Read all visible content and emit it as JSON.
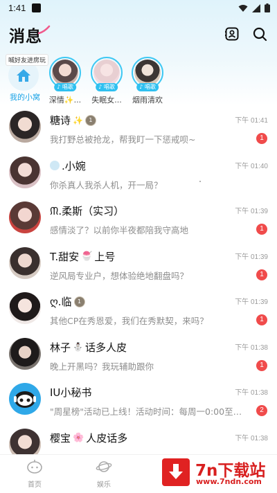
{
  "status_bar": {
    "time": "1:41"
  },
  "header": {
    "title": "消息",
    "contacts_icon": "contacts-icon",
    "search_icon": "search-icon"
  },
  "stories": {
    "tip": "喊好友进房玩",
    "my_room_label": "我的小窝",
    "items": [
      {
        "tag": "♪ 唱歌",
        "name": "深情✨..."
      },
      {
        "tag": "♪ 唱歌",
        "name": "失眠女..."
      },
      {
        "tag": "♪ 唱歌",
        "name": "烟雨清欢"
      }
    ]
  },
  "conversations": [
    {
      "name": "糖诗",
      "time": "下午 01:41",
      "message": "我打野总被抢龙，帮我盯一下惩戒呗~",
      "badge": "1",
      "level": "1"
    },
    {
      "name": ".小婉",
      "time": "下午 01:40",
      "message": "你杀真人我杀人机，开一局？",
      "badge": ""
    },
    {
      "name": "ᙏ.柔斯（实习）",
      "time": "下午 01:39",
      "message": "感情淡了？以前你半夜都陪我守高地",
      "badge": "1"
    },
    {
      "name": "T.甜安",
      "name_suffix": "上号",
      "time": "下午 01:39",
      "message": "逆风局专业户，想体验绝地翻盘吗？",
      "badge": "1"
    },
    {
      "name": "ღ.临",
      "time": "下午 01:39",
      "message": "其他CP在秀恩爱，我们在秀默契，来吗？",
      "badge": "1",
      "level": "1"
    },
    {
      "name": "林子",
      "name_suffix": "话多人皮",
      "time": "下午 01:38",
      "message": "晚上开黑吗？我玩辅助跟你",
      "badge": "1"
    },
    {
      "name": "IU小秘书",
      "time": "下午 01:38",
      "message": "\"周星榜\"活动已上线！活动时间：每周一0:00至周...",
      "badge": "2"
    },
    {
      "name": "樱宝",
      "name_suffix": "人皮话多",
      "time": "下午 01:38",
      "message": "",
      "badge": ""
    }
  ],
  "bottom_nav": [
    {
      "label": "首页",
      "icon": "home-icon"
    },
    {
      "label": "娱乐",
      "icon": "planet-icon"
    }
  ],
  "watermark": {
    "brand": "7n下载站",
    "url": "www.7ndn.com"
  },
  "colors": {
    "accent": "#2fc0f0",
    "badge": "#f04b4b",
    "watermark": "#d81f1f"
  }
}
